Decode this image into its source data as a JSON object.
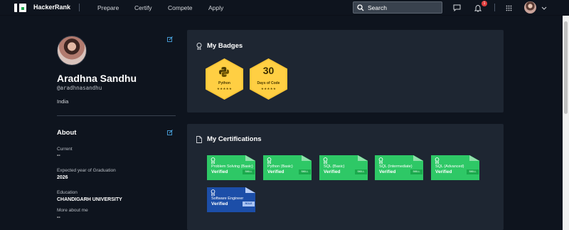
{
  "nav": {
    "brand": "HackerRank",
    "links": [
      "Prepare",
      "Certify",
      "Compete",
      "Apply"
    ],
    "search_placeholder": "Search",
    "notification_count": "1"
  },
  "profile": {
    "name": "Aradhna Sandhu",
    "handle": "@aradhnasandhu",
    "country": "India"
  },
  "about": {
    "title": "About",
    "fields": [
      {
        "label": "Current",
        "value": "--"
      },
      {
        "label": "Expected year of Graduation",
        "value": "2026"
      },
      {
        "label": "Education",
        "value": "CHANDIGARH UNIVERSITY"
      },
      {
        "label": "More about me",
        "value": "--"
      }
    ]
  },
  "badges": {
    "title": "My Badges",
    "items": [
      {
        "name": "Python",
        "stars": "★★★★★"
      },
      {
        "number": "30",
        "name": "Days of Code",
        "stars": "★★★★★"
      }
    ]
  },
  "certifications": {
    "title": "My Certifications",
    "items": [
      {
        "name": "Problem Solving (Basic)",
        "status": "Verified",
        "tag": "SKILL",
        "color": "#2ec866",
        "tag_bg": "#1ba94c",
        "fold": "#8fe0aa"
      },
      {
        "name": "Python (Basic)",
        "status": "Verified",
        "tag": "SKILL",
        "color": "#2ec866",
        "tag_bg": "#1ba94c",
        "fold": "#8fe0aa"
      },
      {
        "name": "SQL (Basic)",
        "status": "Verified",
        "tag": "SKILL",
        "color": "#2ec866",
        "tag_bg": "#1ba94c",
        "fold": "#8fe0aa"
      },
      {
        "name": "SQL (Intermediate)",
        "status": "Verified",
        "tag": "SKILL",
        "color": "#2ec866",
        "tag_bg": "#1ba94c",
        "fold": "#8fe0aa"
      },
      {
        "name": "SQL (Advanced)",
        "status": "Verified",
        "tag": "SKILL",
        "color": "#2ec866",
        "tag_bg": "#1ba94c",
        "fold": "#8fe0aa"
      },
      {
        "name": "Software Engineer",
        "status": "Verified",
        "tag": "ROLE",
        "color": "#1c4ea8",
        "tag_bg": "#a9c3f2",
        "fold": "#b8cdf5"
      }
    ]
  },
  "colors": {
    "background": "#0e141e",
    "card": "#1e2632",
    "accent": "#1ba94c",
    "badge_gold": "#ffcf43",
    "link_icon": "#4aa3df"
  }
}
